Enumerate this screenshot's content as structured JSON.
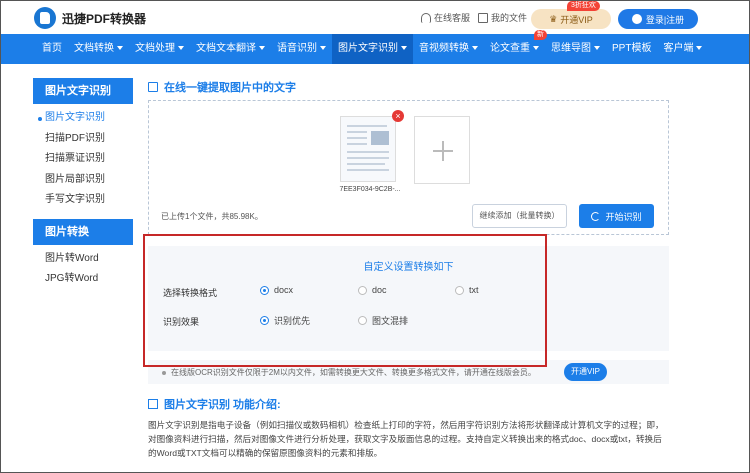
{
  "header": {
    "logo_text": "迅捷PDF转换器",
    "service_label": "在线客服",
    "my_files_label": "我的文件",
    "vip_badge": "3折狂欢",
    "vip_label": "开通VIP",
    "login_label": "登录|注册"
  },
  "nav": {
    "items": [
      {
        "label": "首页",
        "caret": false
      },
      {
        "label": "文档转换",
        "caret": true
      },
      {
        "label": "文档处理",
        "caret": true
      },
      {
        "label": "文档文本翻译",
        "caret": true
      },
      {
        "label": "语音识别",
        "caret": true
      },
      {
        "label": "图片文字识别",
        "caret": true,
        "active": true
      },
      {
        "label": "音视频转换",
        "caret": true
      },
      {
        "label": "论文查重",
        "caret": true,
        "badge": "新"
      },
      {
        "label": "思维导图",
        "caret": true
      },
      {
        "label": "PPT模板",
        "caret": false
      },
      {
        "label": "客户端",
        "caret": true
      }
    ]
  },
  "sidebar": {
    "group1_title": "图片文字识别",
    "group1_items": [
      "图片文字识别",
      "扫描PDF识别",
      "扫描票证识别",
      "图片局部识别",
      "手写文字识别"
    ],
    "group2_title": "图片转换",
    "group2_items": [
      "图片转Word",
      "JPG转Word"
    ]
  },
  "main": {
    "section_title": "在线一键提取图片中的文字",
    "file_name": "7EE3F034-9C2B-...",
    "upload_info": "已上传1个文件，共85.98K。",
    "continue_label": "继续添加（批量转换）",
    "start_label": "开始识别"
  },
  "settings": {
    "title": "自定义设置转换如下",
    "format_label": "选择转换格式",
    "format_options": [
      "docx",
      "doc",
      "txt"
    ],
    "format_selected": "docx",
    "effect_label": "识别效果",
    "effect_options": [
      "识别优先",
      "图文混排"
    ],
    "effect_selected": "识别优先"
  },
  "notice": {
    "text": "在线版OCR识别文件仅限于2M以内文件，如需转换更大文件、转换更多格式文件，请开通在线版会员。",
    "button_label": "开通VIP"
  },
  "intro": {
    "title": "图片文字识别 功能介绍:",
    "text": "图片文字识别是指电子设备（例如扫描仪或数码相机）检查纸上打印的字符，然后用字符识别方法将形状翻译成计算机文字的过程；即，对图像资料进行扫描，然后对图像文件进行分析处理，获取文字及版面信息的过程。支持自定义转换出来的格式doc、docx或txt，转换后的Word或TXT文档可以精确的保留原图像资料的元素和排版。"
  }
}
